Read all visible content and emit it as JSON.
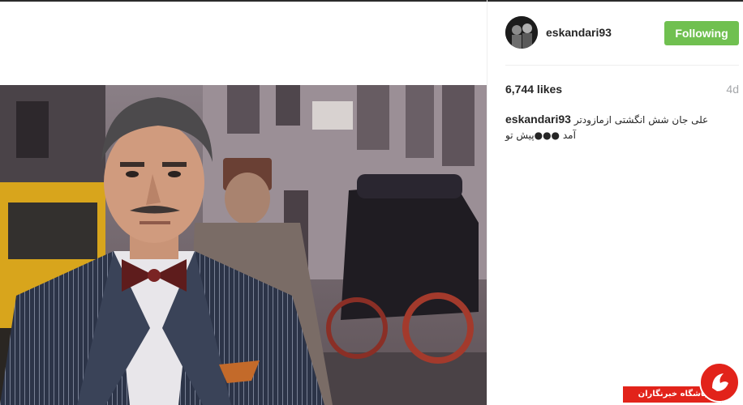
{
  "post": {
    "username": "eskandari93",
    "follow_label": "Following",
    "likes": "6,744 likes",
    "age": "4d",
    "caption_user": "eskandari93",
    "caption_text": "علی جان شش انگشتی ازمازودتر آمد ●●●پیش تو"
  },
  "watermark": {
    "text": "باشگاه خبرنگاران"
  },
  "colors": {
    "follow_button": "#70c050",
    "text_primary": "#262626",
    "text_secondary": "#a5a7aa",
    "watermark_red": "#e2231a"
  },
  "icons": {
    "avatar": "profile-photo",
    "watermark_logo": "yjc-logo-icon"
  }
}
